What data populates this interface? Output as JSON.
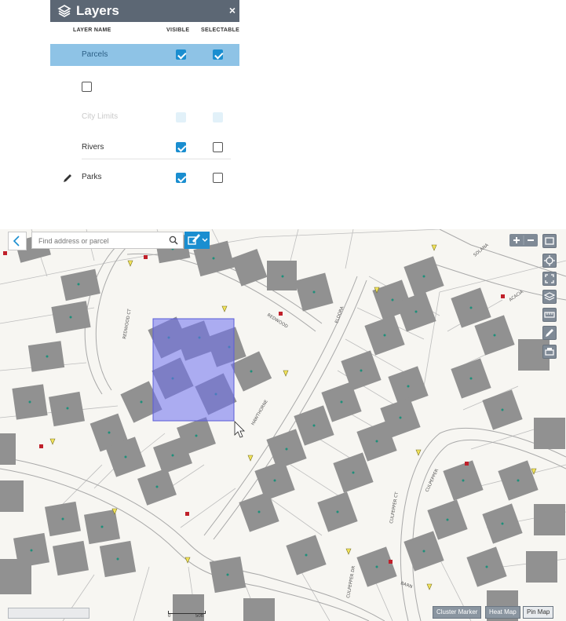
{
  "layers_panel": {
    "title": "Layers",
    "close": "×",
    "columns": {
      "name": "LAYER NAME",
      "visible": "VISIBLE",
      "selectable": "SELECTABLE"
    },
    "layers": [
      {
        "name": "Parcels",
        "visible": true,
        "selectable": true,
        "highlighted": true
      },
      {
        "name": "",
        "visible": false,
        "selectable": null
      },
      {
        "name": "City Limits",
        "visible": true,
        "selectable": true,
        "faded": true
      },
      {
        "name": "Rivers",
        "visible": true,
        "selectable": false
      },
      {
        "name": "Parks",
        "visible": true,
        "selectable": false,
        "edit_icon": "pencil-icon"
      }
    ]
  },
  "map": {
    "search": {
      "placeholder": "Find address or parcel"
    },
    "street_labels": [
      "REDWOOD CT",
      "REDWOOD",
      "ELDORA",
      "CULPEPPER DR",
      "CULPEPPER CT",
      "CULPEPPER",
      "SOLANA",
      "ACACIA",
      "BARN",
      "HAWTHORNE"
    ],
    "bottom_buttons": [
      "Cluster Marker",
      "Heat Map",
      "Pin Map"
    ],
    "active_bottom": "Pin Map",
    "scale": {
      "left": "0",
      "right": "50ft"
    },
    "selection_color": "#6d6ff0",
    "accent": "#1a8ed0"
  }
}
